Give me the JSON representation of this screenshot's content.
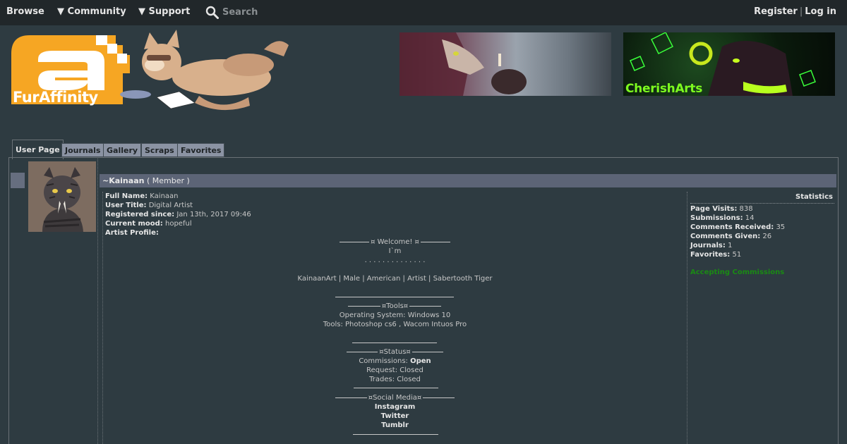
{
  "nav": {
    "browse": "Browse",
    "community": "▼ Community",
    "support": "▼ Support",
    "search_label": "Search",
    "register": "Register",
    "separator": "|",
    "login": "Log in"
  },
  "logo": {
    "text": "FurAffinity",
    "letter": "a"
  },
  "banners": [
    {
      "name": "banner-ad-1"
    },
    {
      "name": "banner-ad-2",
      "text": "CherishArts"
    }
  ],
  "tabs": [
    "User Page",
    "Journals",
    "Gallery",
    "Scraps",
    "Favorites"
  ],
  "user": {
    "name_prefix": "~",
    "name": "Kainaan",
    "role": "( Member )"
  },
  "info": [
    {
      "label": "Full Name:",
      "value": "Kainaan"
    },
    {
      "label": "User Title:",
      "value": "Digital Artist"
    },
    {
      "label": "Registered since:",
      "value": "Jan 13th, 2017 09:46"
    },
    {
      "label": "Current mood:",
      "value": "hopeful"
    },
    {
      "label": "Artist Profile:",
      "value": ""
    }
  ],
  "profile": {
    "welcome": "¤ Welcome! ¤",
    "im": "I`m",
    "dots": ". . . . . . . . . . . . . .",
    "tagline": "KainaanArt | Male | American | Artist | Sabertooth Tiger",
    "tools_header": "¤Tools¤",
    "tools_os": "Operating System: Windows 10",
    "tools_software": "Tools: Photoshop cs6 , Wacom Intuos Pro",
    "status_header": "¤Status¤",
    "commissions_label": "Commissions:",
    "commissions_value": "Open",
    "request": "Request: Closed",
    "trades": "Trades: Closed",
    "social_header": "¤Social Media¤",
    "social": [
      "Instagram",
      "Twitter",
      "Tumblr"
    ]
  },
  "stats": {
    "header": "Statistics",
    "items": [
      {
        "label": "Page Visits:",
        "value": "838"
      },
      {
        "label": "Submissions:",
        "value": "14"
      },
      {
        "label": "Comments Received:",
        "value": "35"
      },
      {
        "label": "Comments Given:",
        "value": "26"
      },
      {
        "label": "Journals:",
        "value": "1"
      },
      {
        "label": "Favorites:",
        "value": "51"
      }
    ],
    "commission_status": "Accepting Commissions"
  },
  "colors": {
    "nav_bg": "#21272a",
    "page_bg": "#2e3b41",
    "title_bar": "#5c6476",
    "tab_bg": "#8b93a3",
    "logo_orange": "#f6a623",
    "commission_green": "#1a8a14",
    "banner_green": "#7dfb1f"
  }
}
